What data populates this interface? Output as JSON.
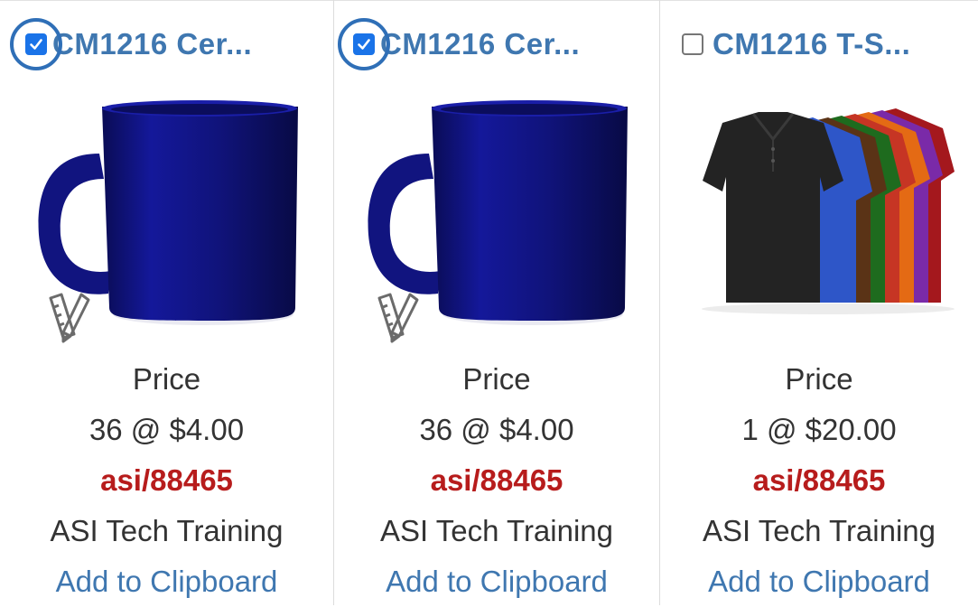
{
  "products": [
    {
      "title": "CM1216  Cer...",
      "checked": true,
      "image": "blue-mug",
      "price_label": "Price",
      "price": "36 @ $4.00",
      "asi": "asi/88465",
      "supplier": "ASI Tech Training",
      "action": "Add to Clipboard"
    },
    {
      "title": "CM1216  Cer...",
      "checked": true,
      "image": "blue-mug",
      "price_label": "Price",
      "price": "36 @ $4.00",
      "asi": "asi/88465",
      "supplier": "ASI Tech Training",
      "action": "Add to Clipboard"
    },
    {
      "title": "CM1216  T-S...",
      "checked": false,
      "image": "polo-shirts-multicolor",
      "price_label": "Price",
      "price": "1 @ $20.00",
      "asi": "asi/88465",
      "supplier": "ASI Tech Training",
      "action": "Add to Clipboard"
    }
  ],
  "colors": {
    "link": "#3f77b0",
    "asi": "#b71c1c",
    "checkbox_checked": "#1a73e8",
    "highlight_ring": "#2f6fb7",
    "mug": "#10137a"
  },
  "icons": {
    "checkmark": "checkmark-icon",
    "decorator": "pencil-ruler-icon"
  }
}
